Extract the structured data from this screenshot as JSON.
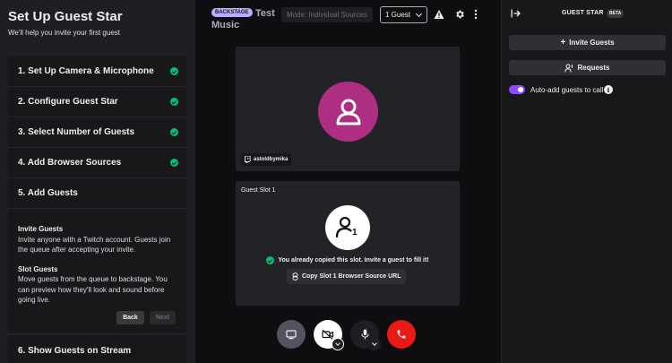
{
  "left": {
    "title": "Set Up Guest Star",
    "subtitle": "We'll help you invite your first guest",
    "steps": [
      {
        "label": "1. Set Up Camera & Microphone",
        "done": true
      },
      {
        "label": "2. Configure Guest Star",
        "done": true
      },
      {
        "label": "3. Select Number of Guests",
        "done": true
      },
      {
        "label": "4. Add Browser Sources",
        "done": true
      },
      {
        "label": "5. Add Guests",
        "done": false
      }
    ],
    "step5": {
      "invite_heading": "Invite Guests",
      "invite_text": "Invite anyone with a Twitch account. Guests join the queue after accepting your invite.",
      "slot_heading": "Slot Guests",
      "slot_text": "Move guests from the queue to backstage. You can preview how they'll look and sound before going live.",
      "back_label": "Back",
      "next_label": "Next"
    },
    "step6_label": "6. Show Guests on Stream"
  },
  "center": {
    "badge": "BACKSTAGE",
    "title_line1": "Test",
    "title_line2": "Music",
    "mode_label": "Mode: Individual Sources",
    "guest_count": "1 Guest",
    "host_name": "astoldbymika",
    "slot_label": "Guest Slot 1",
    "slot_number": "1",
    "copied_msg": "You already copied this slot. Invite a guest to fill it!",
    "copy_button": "Copy Slot 1 Browser Source URL"
  },
  "right": {
    "title": "GUEST STAR",
    "beta": "BETA",
    "invite_button": "Invite Guests",
    "requests_button": "Requests",
    "auto_add_label": "Auto-add guests to call",
    "auto_add_on": true
  },
  "colors": {
    "accent": "#9147ff",
    "success": "#00c274",
    "avatar": "#ad2e83",
    "end_call": "#e91916"
  }
}
